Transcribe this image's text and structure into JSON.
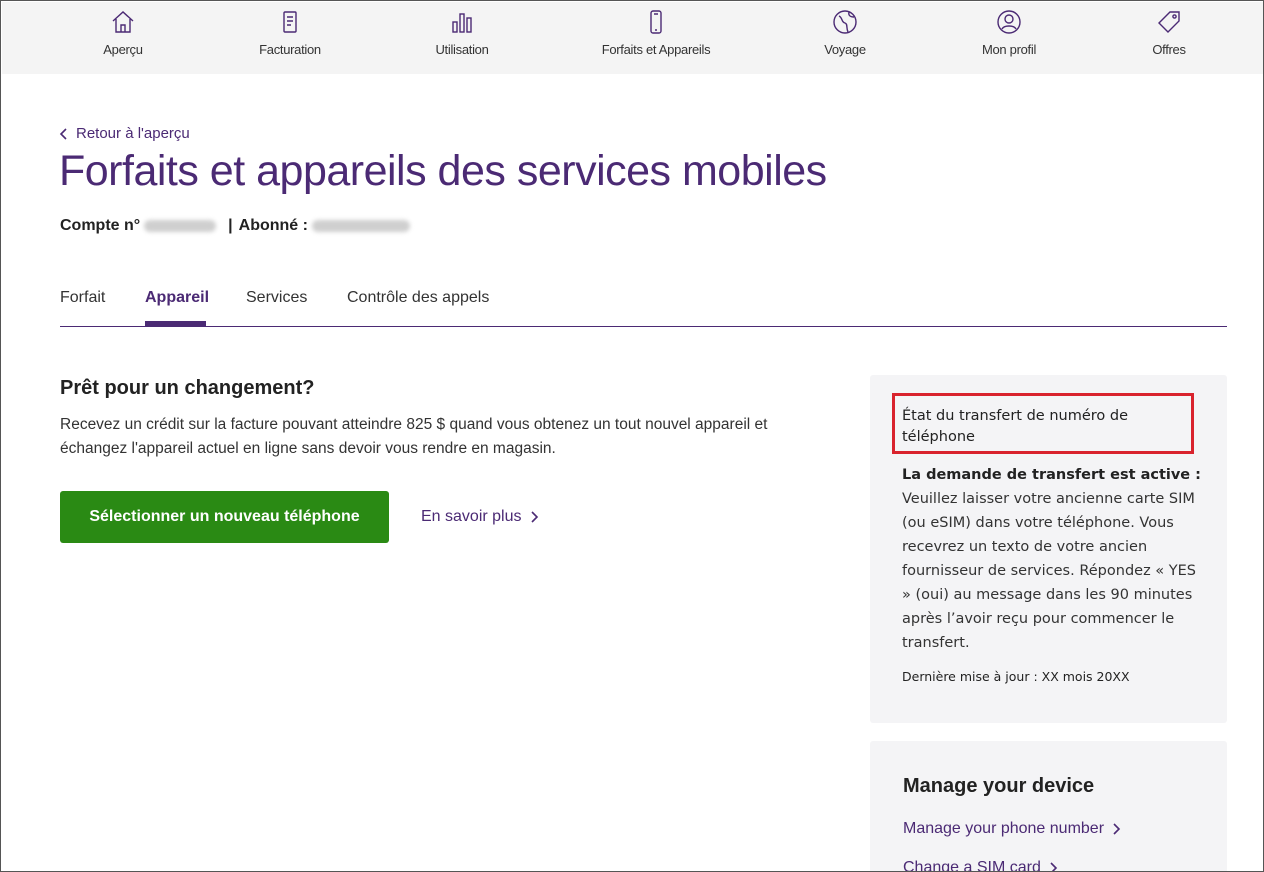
{
  "nav": {
    "items": [
      {
        "label": "Aperçu",
        "icon": "home-icon"
      },
      {
        "label": "Facturation",
        "icon": "bill-icon"
      },
      {
        "label": "Utilisation",
        "icon": "bar-chart-icon"
      },
      {
        "label": "Forfaits et Appareils",
        "icon": "phone-icon"
      },
      {
        "label": "Voyage",
        "icon": "globe-icon"
      },
      {
        "label": "Mon profil",
        "icon": "profile-icon"
      },
      {
        "label": "Offres",
        "icon": "tag-icon"
      }
    ]
  },
  "header": {
    "back_label": "Retour à l'aperçu",
    "title": "Forfaits et appareils des services mobiles",
    "account_label": "Compte n°",
    "subscriber_label": "Abonné :",
    "separator": "|"
  },
  "tabs": [
    {
      "label": "Forfait",
      "active": false
    },
    {
      "label": "Appareil",
      "active": true
    },
    {
      "label": "Services",
      "active": false
    },
    {
      "label": "Contrôle des appels",
      "active": false
    }
  ],
  "promo": {
    "title": "Prêt pour un changement?",
    "text": "Recevez un crédit sur la facture pouvant atteindre 825 $ quand vous obtenez un tout nouvel appareil et échangez l'appareil actuel en ligne sans devoir vous rendre en magasin.",
    "button_label": "Sélectionner un nouveau téléphone",
    "learn_more_label": "En savoir plus"
  },
  "transfer": {
    "title": "État du transfert de numéro de téléphone",
    "status_heading": "La demande de transfert est active :",
    "status_text": "Veuillez laisser votre ancienne carte SIM (ou eSIM) dans votre téléphone. Vous recevrez un texto de votre ancien fournisseur de services. Répondez « YES » (oui) au message dans les 90 minutes après l’avoir reçu pour commencer le transfert.",
    "updated": "Dernière mise à jour : XX mois 20XX"
  },
  "manage": {
    "title": "Manage your device",
    "links": [
      "Manage your phone number",
      "Change a SIM card"
    ]
  },
  "colors": {
    "brand": "#4b2a74",
    "button": "#2a8a14",
    "highlight": "#d9232d",
    "card_bg": "#f4f4f6"
  }
}
